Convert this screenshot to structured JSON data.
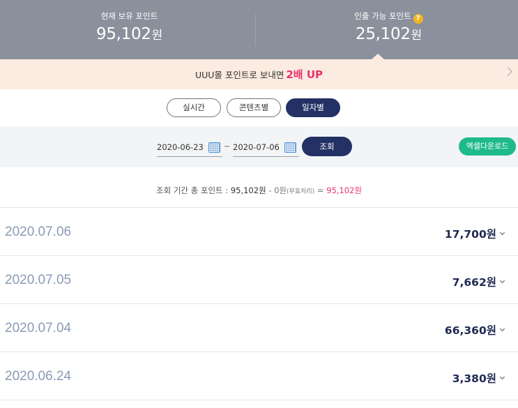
{
  "header": {
    "held_points": {
      "label": "현재 보유 포인트",
      "value": "95,102",
      "unit": "원"
    },
    "withdrawable_points": {
      "label": "인출 가능 포인트",
      "value": "25,102",
      "unit": "원",
      "help_icon": "?"
    }
  },
  "promo": {
    "text": "UUU몰 포인트로 보내면",
    "highlight": "2배 UP"
  },
  "tabs": [
    {
      "label": "실시간",
      "active": false
    },
    {
      "label": "콘텐츠별",
      "active": false
    },
    {
      "label": "일자별",
      "active": true
    }
  ],
  "filter": {
    "start_date": "2020-06-23",
    "separator": "~",
    "end_date": "2020-07-06",
    "search_label": "조회",
    "excel_label": "엑셀다운로드"
  },
  "summary": {
    "prefix": "조회 기간 총 포인트 :",
    "total": "95,102원",
    "minus": "- 0원",
    "note": "(무효처리)",
    "equals": "=",
    "result": "95,102원"
  },
  "rows": [
    {
      "date": "2020.07.06",
      "amount": "17,700원"
    },
    {
      "date": "2020.07.05",
      "amount": "7,662원"
    },
    {
      "date": "2020.07.04",
      "amount": "66,360원"
    },
    {
      "date": "2020.06.24",
      "amount": "3,380원"
    }
  ],
  "colors": {
    "header_bg": "#8a919c",
    "promo_bg": "#fbebe0",
    "accent_red": "#e8336d",
    "navy": "#233165",
    "excel_green": "#1fba8a",
    "help_yellow": "#f3b61f"
  }
}
